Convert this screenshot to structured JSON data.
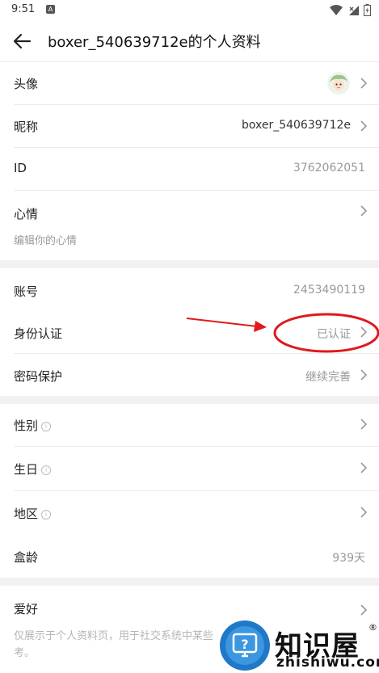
{
  "status_bar": {
    "time": "9:51",
    "app_badge": "A"
  },
  "header": {
    "title": "boxer_540639712e的个人资料"
  },
  "rows": {
    "avatar": {
      "label": "头像"
    },
    "nickname": {
      "label": "昵称",
      "value": "boxer_540639712e"
    },
    "id": {
      "label": "ID",
      "value": "3762062051"
    },
    "mood": {
      "label": "心情",
      "placeholder": "编辑你的心情"
    },
    "account": {
      "label": "账号",
      "value": "2453490119"
    },
    "identity": {
      "label": "身份认证",
      "value": "已认证"
    },
    "password": {
      "label": "密码保护",
      "value": "继续完善"
    },
    "gender": {
      "label": "性别"
    },
    "birthday": {
      "label": "生日"
    },
    "region": {
      "label": "地区"
    },
    "box_age": {
      "label": "盒龄",
      "value": "939天"
    },
    "hobby": {
      "label": "爱好",
      "note_line1": "仅展示于个人资料页，用于社交系统中某些",
      "note_line2": "考。"
    }
  },
  "info_icon": "i",
  "watermark": {
    "brand": "知识屋",
    "domain": "zhishiwu.com",
    "registered": "®"
  },
  "colors": {
    "annotation": "#e0191c",
    "divider": "#ececec",
    "section_gap": "#f2f2f2",
    "muted_text": "#999999"
  }
}
